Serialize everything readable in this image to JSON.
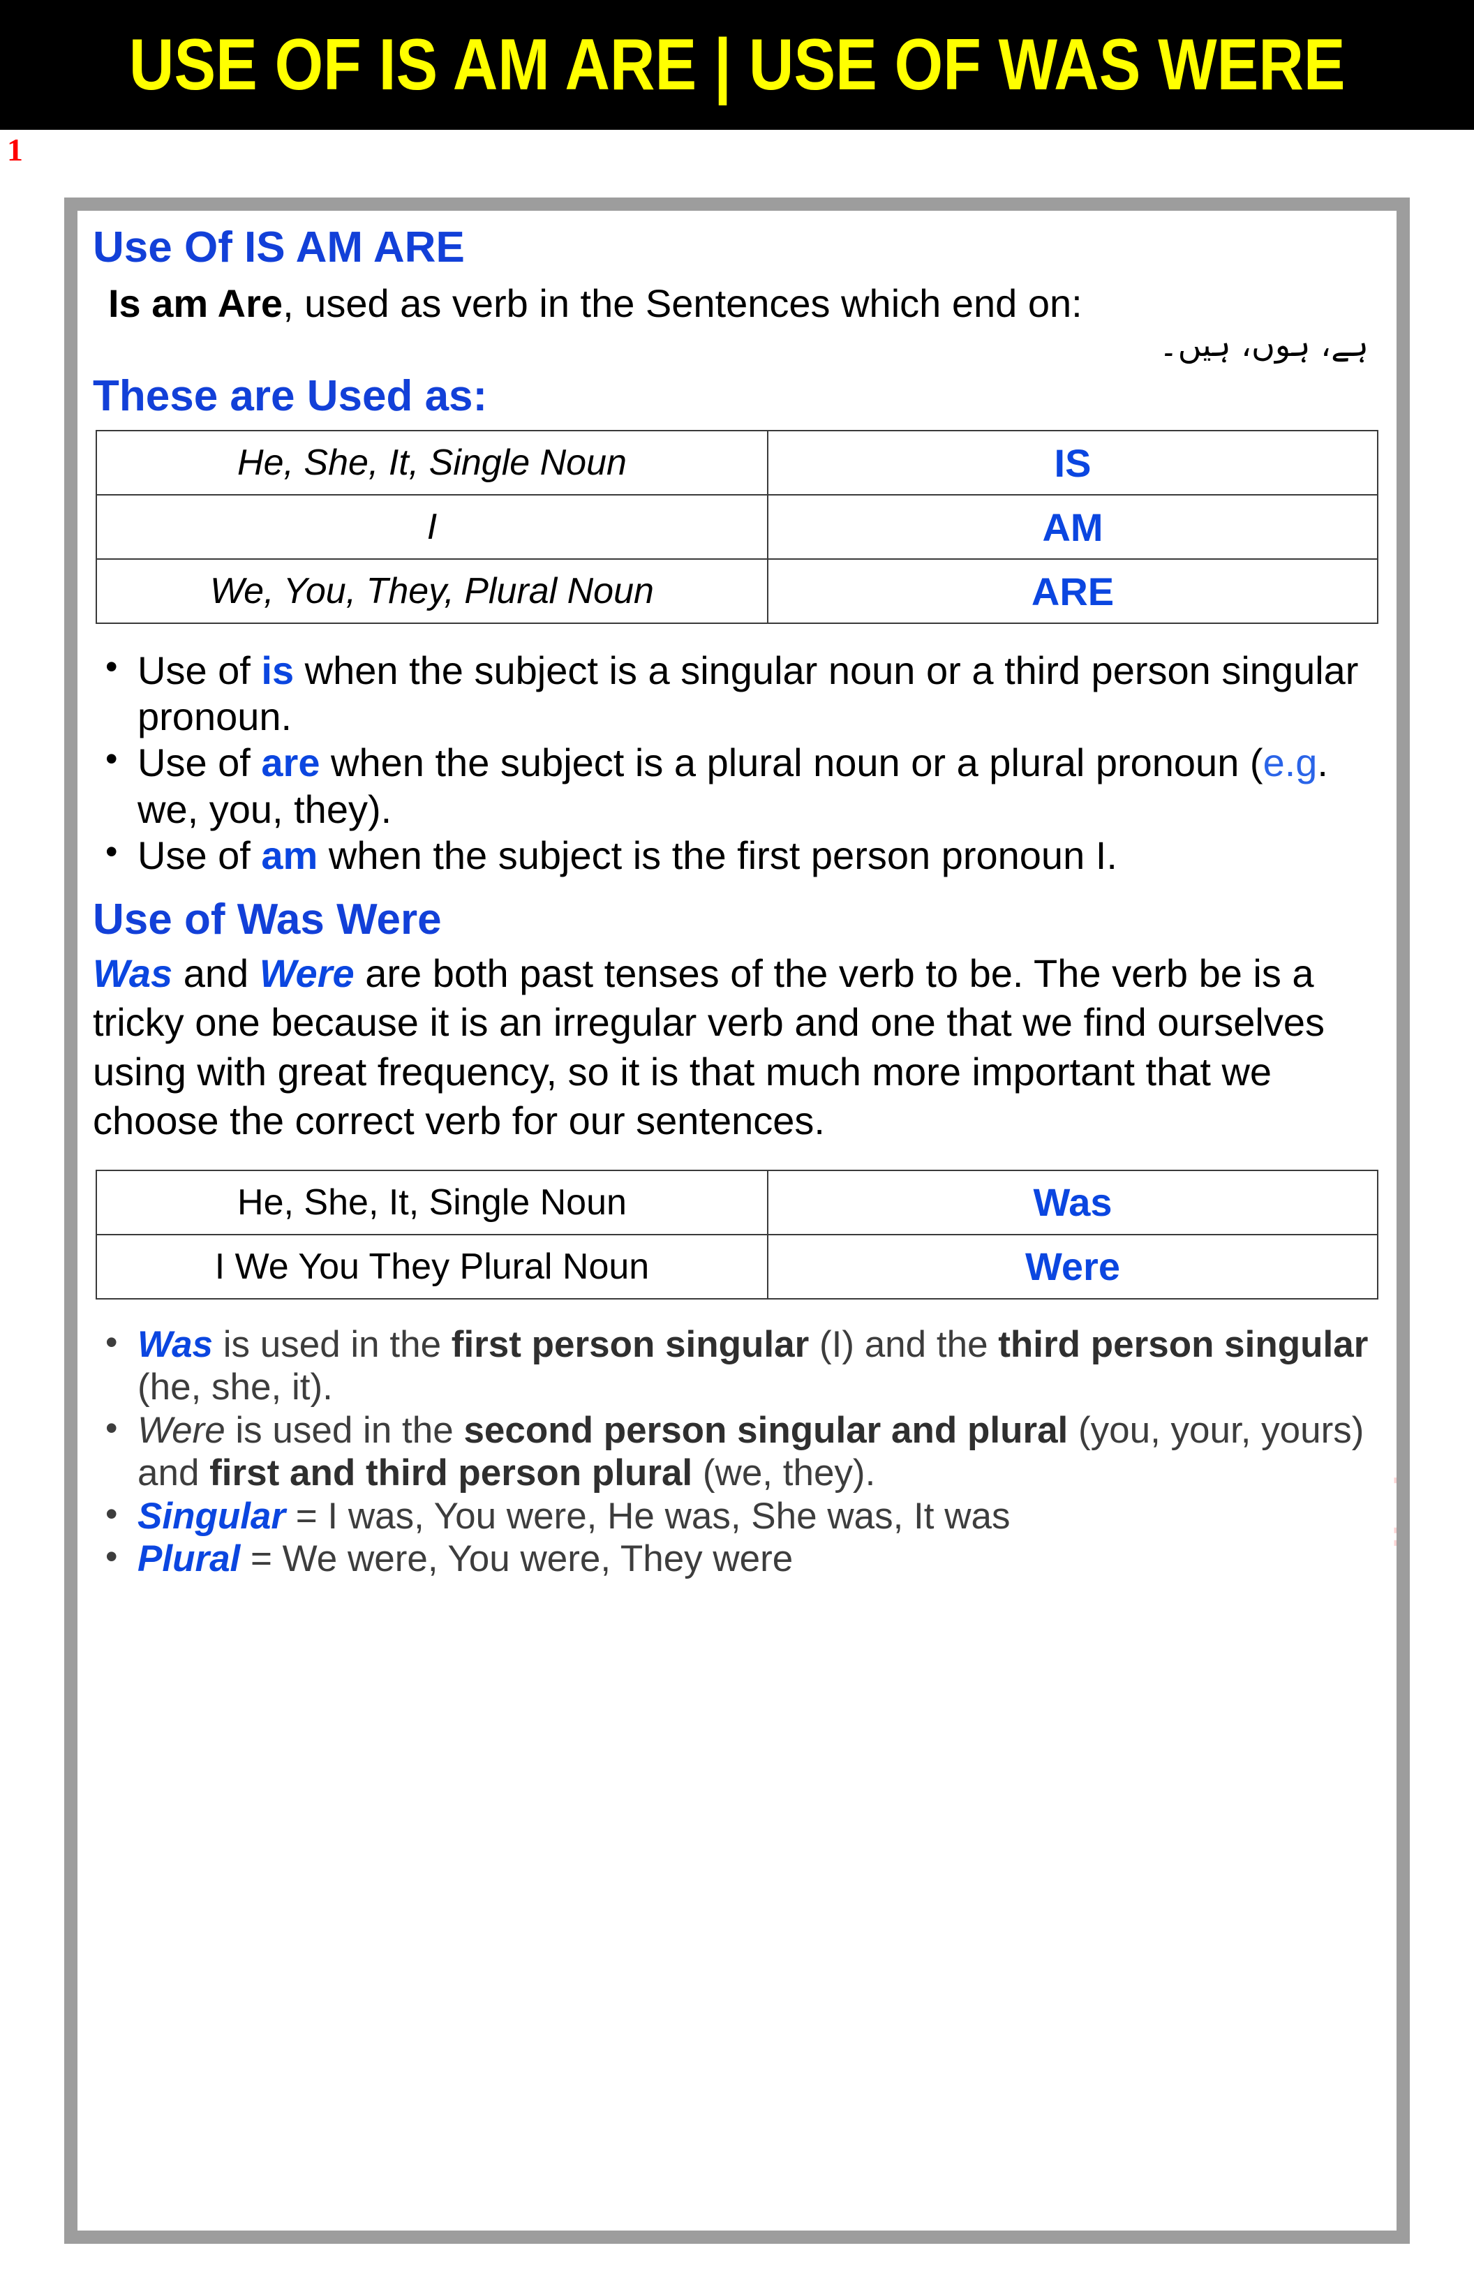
{
  "banner": {
    "title": "USE OF IS AM ARE | USE OF WAS WERE",
    "bg_color": "#000000",
    "text_color": "#FFFF00"
  },
  "slide_number": "1",
  "watermark": {
    "text": "www.ilmist.com",
    "color": "#FBD4D4"
  },
  "accent_color": "#0B46E0",
  "section_isamare": {
    "heading": "Use Of IS AM ARE",
    "lead_bold": "Is am Are",
    "lead_rest": ",  used as verb in the Sentences which end on:",
    "urdu": "ہے، ہوں، ہیں۔",
    "subheading": "These are Used as:",
    "table": {
      "rows": [
        {
          "subject": "He, She, It, Single Noun",
          "verb": "IS"
        },
        {
          "subject": "I",
          "verb": "AM"
        },
        {
          "subject": "We, You, They, Plural Noun",
          "verb": "ARE"
        }
      ]
    },
    "bullets": [
      {
        "pre": "Use of ",
        "kw": "is",
        "post": " when the subject is a singular noun or a third person singular pronoun."
      },
      {
        "pre": "Use of ",
        "kw": "are",
        "post_a": " when the subject is a plural noun or a plural pronoun (",
        "eg": "e.g",
        "post_b": ". we, you, they)."
      },
      {
        "pre": "Use of ",
        "kw": "am",
        "post": " when the subject is the first person pronoun I."
      }
    ]
  },
  "section_waswere": {
    "heading": "Use of Was Were",
    "para": {
      "kw1": "Was",
      "mid1": " and ",
      "kw2": "Were",
      "rest": " are both past tenses of the verb to be. The verb be is a tricky one because it is an irregular verb and one that we find ourselves using with great frequency, so it is that much more important that we choose the correct verb for our sentences."
    },
    "table": {
      "rows": [
        {
          "subject": "He, She, It, Single Noun",
          "verb": "Was"
        },
        {
          "subject": "I We You They Plural Noun",
          "verb": "Were"
        }
      ]
    },
    "bullets": [
      {
        "kw": "Was",
        "p1": " is used in the ",
        "b1": "first person singular",
        "p2": " (I) and the ",
        "b2": "third person singular",
        "p3": " (he, she, it)."
      },
      {
        "it": "Were",
        "p1": " is used in the ",
        "b1": "second person singular and plural",
        "p2": " (you, your, yours) and ",
        "b2": "first and third person plural",
        "p3": " (we, they)."
      },
      {
        "kw": "Singular",
        "p1": " = I was, You were, He was, She was, It was"
      },
      {
        "kw": "Plural",
        "p1": " = We were, You were, They were"
      }
    ]
  }
}
